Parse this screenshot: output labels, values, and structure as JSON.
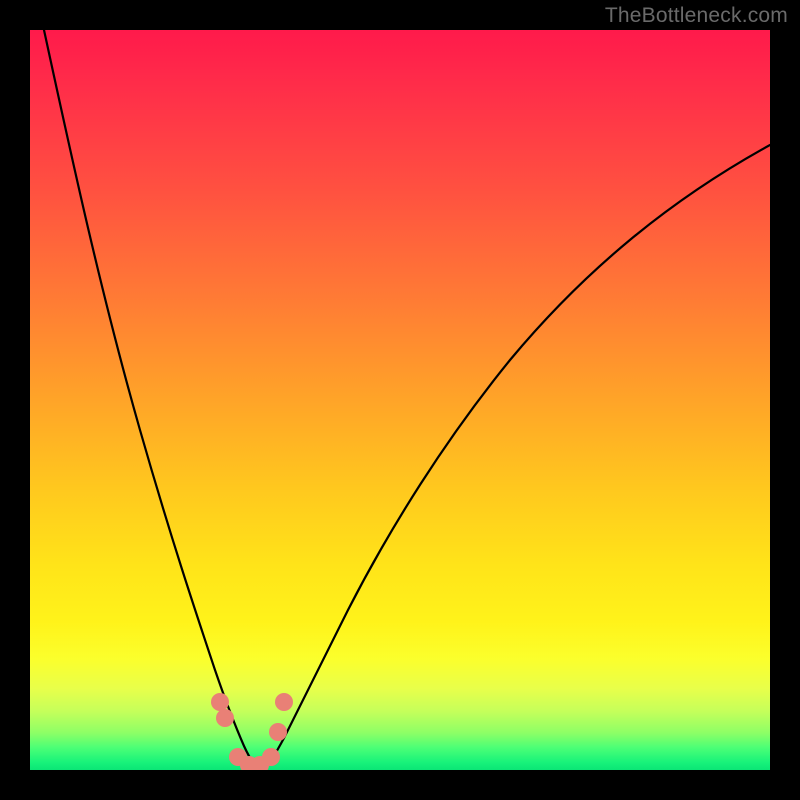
{
  "watermark": "TheBottleneck.com",
  "colors": {
    "frame": "#000000",
    "gradient_top": "#ff1a4b",
    "gradient_bottom": "#0be576",
    "curve": "#000000",
    "marker": "#e98076"
  },
  "chart_data": {
    "type": "line",
    "title": "",
    "xlabel": "",
    "ylabel": "",
    "xlim": [
      0,
      100
    ],
    "ylim": [
      0,
      100
    ],
    "grid": false,
    "legend": false,
    "note": "Two curves descending steeply into a narrow valley near x≈27-33 (y≈0) then rising; background gradient encodes y (red=high bottleneck, green=low). Salmon markers cluster at the valley floor.",
    "series": [
      {
        "name": "left-curve",
        "x": [
          2,
          5,
          8,
          11,
          14,
          17,
          20,
          23,
          25,
          27,
          29,
          31
        ],
        "y": [
          100,
          88,
          76,
          64,
          52,
          40,
          29,
          18,
          10,
          4,
          1,
          0
        ]
      },
      {
        "name": "right-curve",
        "x": [
          31,
          33,
          35,
          38,
          42,
          47,
          53,
          60,
          68,
          77,
          87,
          100
        ],
        "y": [
          0,
          1,
          3,
          7,
          14,
          24,
          35,
          47,
          58,
          68,
          77,
          85
        ]
      }
    ],
    "markers": [
      {
        "x": 25.5,
        "y": 9
      },
      {
        "x": 26.3,
        "y": 7
      },
      {
        "x": 28.0,
        "y": 1.5
      },
      {
        "x": 29.5,
        "y": 0.5
      },
      {
        "x": 31.0,
        "y": 0.5
      },
      {
        "x": 32.5,
        "y": 1.5
      },
      {
        "x": 33.5,
        "y": 5
      },
      {
        "x": 34.3,
        "y": 9
      }
    ]
  }
}
